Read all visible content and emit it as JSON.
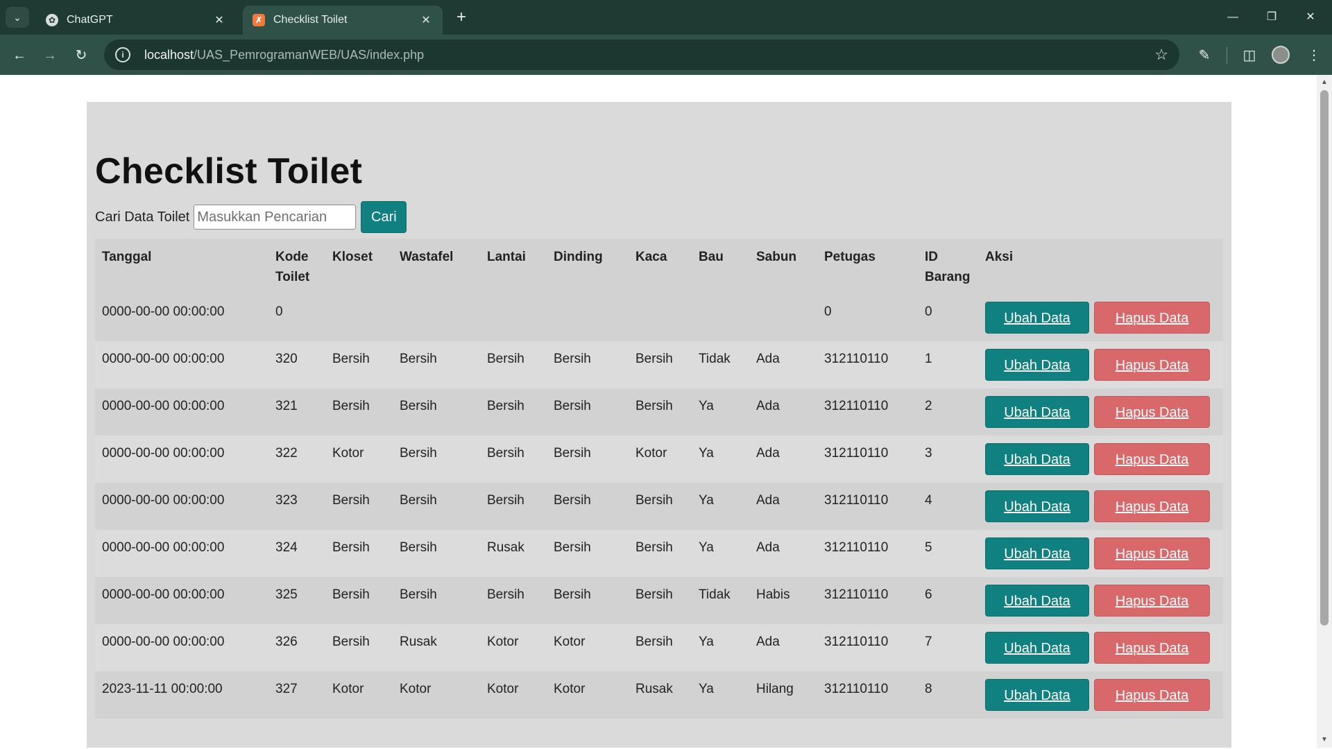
{
  "browser": {
    "tabs": [
      {
        "title": "ChatGPT",
        "active": false
      },
      {
        "title": "Checklist Toilet",
        "active": true
      }
    ],
    "url_host": "localhost",
    "url_path": "/UAS_PemrogramanWEB/UAS/index.php"
  },
  "page": {
    "title": "Checklist Toilet",
    "search": {
      "label": "Cari Data Toilet",
      "placeholder": "Masukkan Pencarian",
      "button": "Cari"
    },
    "table": {
      "headers": [
        "Tanggal",
        "Kode Toilet",
        "Kloset",
        "Wastafel",
        "Lantai",
        "Dinding",
        "Kaca",
        "Bau",
        "Sabun",
        "Petugas",
        "ID Barang",
        "Aksi"
      ],
      "edit_label": "Ubah Data",
      "delete_label": "Hapus Data",
      "rows": [
        [
          "0000-00-00 00:00:00",
          "0",
          "",
          "",
          "",
          "",
          "",
          "",
          "",
          "0",
          "0"
        ],
        [
          "0000-00-00 00:00:00",
          "320",
          "Bersih",
          "Bersih",
          "Bersih",
          "Bersih",
          "Bersih",
          "Tidak",
          "Ada",
          "312110110",
          "1"
        ],
        [
          "0000-00-00 00:00:00",
          "321",
          "Bersih",
          "Bersih",
          "Bersih",
          "Bersih",
          "Bersih",
          "Ya",
          "Ada",
          "312110110",
          "2"
        ],
        [
          "0000-00-00 00:00:00",
          "322",
          "Kotor",
          "Bersih",
          "Bersih",
          "Bersih",
          "Kotor",
          "Ya",
          "Ada",
          "312110110",
          "3"
        ],
        [
          "0000-00-00 00:00:00",
          "323",
          "Bersih",
          "Bersih",
          "Bersih",
          "Bersih",
          "Bersih",
          "Ya",
          "Ada",
          "312110110",
          "4"
        ],
        [
          "0000-00-00 00:00:00",
          "324",
          "Bersih",
          "Bersih",
          "Rusak",
          "Bersih",
          "Bersih",
          "Ya",
          "Ada",
          "312110110",
          "5"
        ],
        [
          "0000-00-00 00:00:00",
          "325",
          "Bersih",
          "Bersih",
          "Bersih",
          "Bersih",
          "Bersih",
          "Tidak",
          "Habis",
          "312110110",
          "6"
        ],
        [
          "0000-00-00 00:00:00",
          "326",
          "Bersih",
          "Rusak",
          "Kotor",
          "Kotor",
          "Bersih",
          "Ya",
          "Ada",
          "312110110",
          "7"
        ],
        [
          "2023-11-11 00:00:00",
          "327",
          "Kotor",
          "Kotor",
          "Kotor",
          "Kotor",
          "Rusak",
          "Ya",
          "Hilang",
          "312110110",
          "8"
        ]
      ]
    }
  },
  "colors": {
    "chrome_dark": "#1f3a33",
    "chrome_toolbar": "#2f5148",
    "page_panel": "#dadada",
    "edit_button": "#108080",
    "delete_button": "#d9686a"
  }
}
